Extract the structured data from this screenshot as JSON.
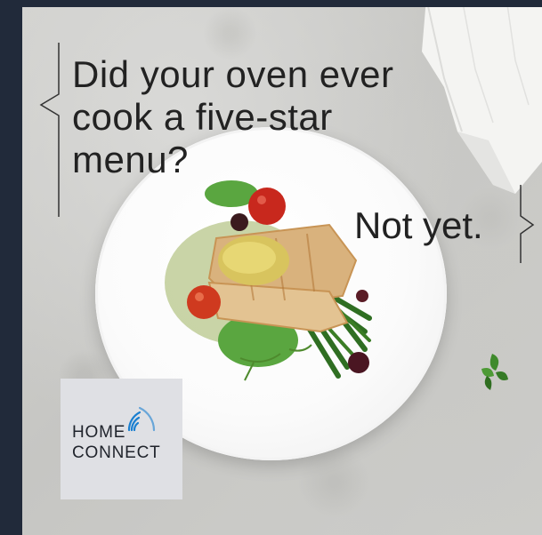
{
  "ad": {
    "headline_lines": [
      "Did your oven ever",
      "cook a five-star",
      "menu?"
    ],
    "tagline": "Not yet.",
    "logo": {
      "line1": "Home",
      "line2": "connect",
      "icon": "wifi-signal-icon"
    }
  },
  "colors": {
    "frame": "#212a3a",
    "text": "#222222",
    "logo_bg": "#dfe0e4",
    "logo_accent": "#1a7fd0"
  }
}
